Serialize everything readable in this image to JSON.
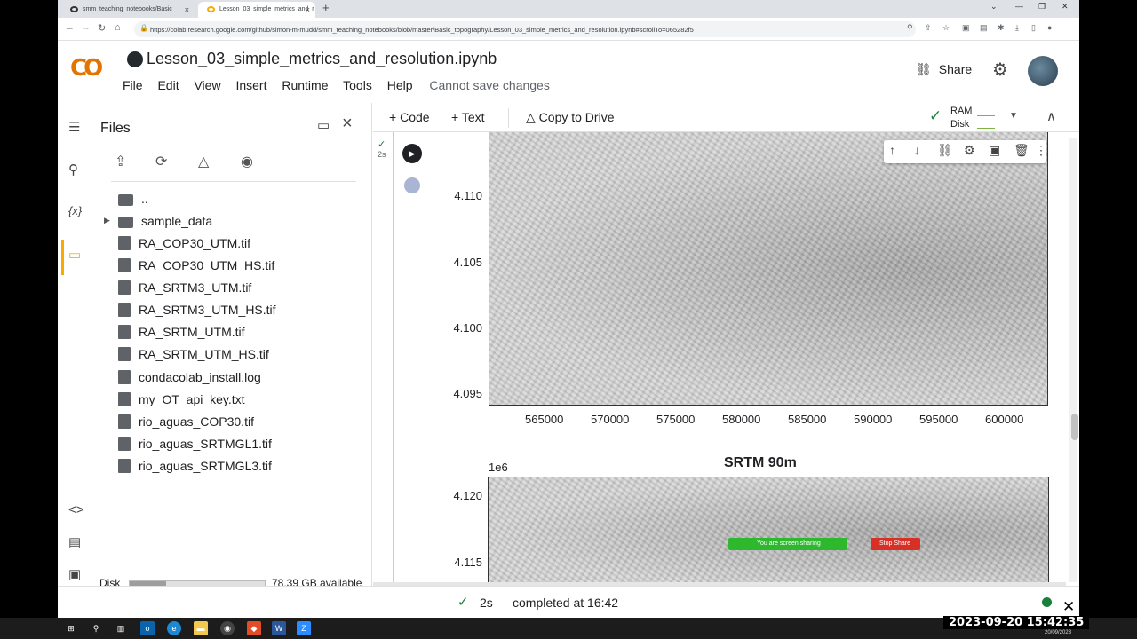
{
  "browser": {
    "tabs": [
      {
        "label": "smm_teaching_notebooks/Basic"
      },
      {
        "label": "Lesson_03_simple_metrics_and_r"
      }
    ],
    "url": "https://colab.research.google.com/github/simon-m-mudd/smm_teaching_notebooks/blob/master/Basic_topography/Lesson_03_simple_metrics_and_resolution.ipynb#scrollTo=065282f5"
  },
  "header": {
    "logo": "CO",
    "title": "Lesson_03_simple_metrics_and_resolution.ipynb",
    "menu": [
      "File",
      "Edit",
      "View",
      "Insert",
      "Runtime",
      "Tools",
      "Help"
    ],
    "cannot_save": "Cannot save changes",
    "share": "Share"
  },
  "files": {
    "title": "Files",
    "parent": "..",
    "items": [
      {
        "name": "sample_data",
        "type": "folder"
      },
      {
        "name": "RA_COP30_UTM.tif",
        "type": "file"
      },
      {
        "name": "RA_COP30_UTM_HS.tif",
        "type": "file"
      },
      {
        "name": "RA_SRTM3_UTM.tif",
        "type": "file"
      },
      {
        "name": "RA_SRTM3_UTM_HS.tif",
        "type": "file"
      },
      {
        "name": "RA_SRTM_UTM.tif",
        "type": "file"
      },
      {
        "name": "RA_SRTM_UTM_HS.tif",
        "type": "file"
      },
      {
        "name": "condacolab_install.log",
        "type": "file"
      },
      {
        "name": "my_OT_api_key.txt",
        "type": "file"
      },
      {
        "name": "rio_aguas_COP30.tif",
        "type": "file"
      },
      {
        "name": "rio_aguas_SRTMGL1.tif",
        "type": "file"
      },
      {
        "name": "rio_aguas_SRTMGL3.tif",
        "type": "file"
      }
    ],
    "disk_label": "Disk",
    "disk_fraction": 0.27,
    "disk_available": "78.39 GB available"
  },
  "toolbar": {
    "code": "Code",
    "text": "Text",
    "copy_drive": "Copy to Drive",
    "ram": "RAM",
    "disk": "Disk"
  },
  "cell": {
    "exec_time": "2s"
  },
  "plot1": {
    "yticks": [
      "4.110",
      "4.105",
      "4.100",
      "4.095"
    ],
    "xticks": [
      "565000",
      "570000",
      "575000",
      "580000",
      "585000",
      "590000",
      "595000",
      "600000"
    ]
  },
  "plot2": {
    "title": "SRTM 90m",
    "exponent": "1e6",
    "yticks": [
      "4.120",
      "4.115"
    ]
  },
  "screenshare": {
    "message": "You are screen sharing",
    "stop": "Stop Share"
  },
  "status": {
    "time": "2s",
    "message": "completed at 16:42"
  },
  "taskbar": {
    "datetime": "2023-09-20  15:42:35",
    "date_small": "20/09/2023"
  }
}
